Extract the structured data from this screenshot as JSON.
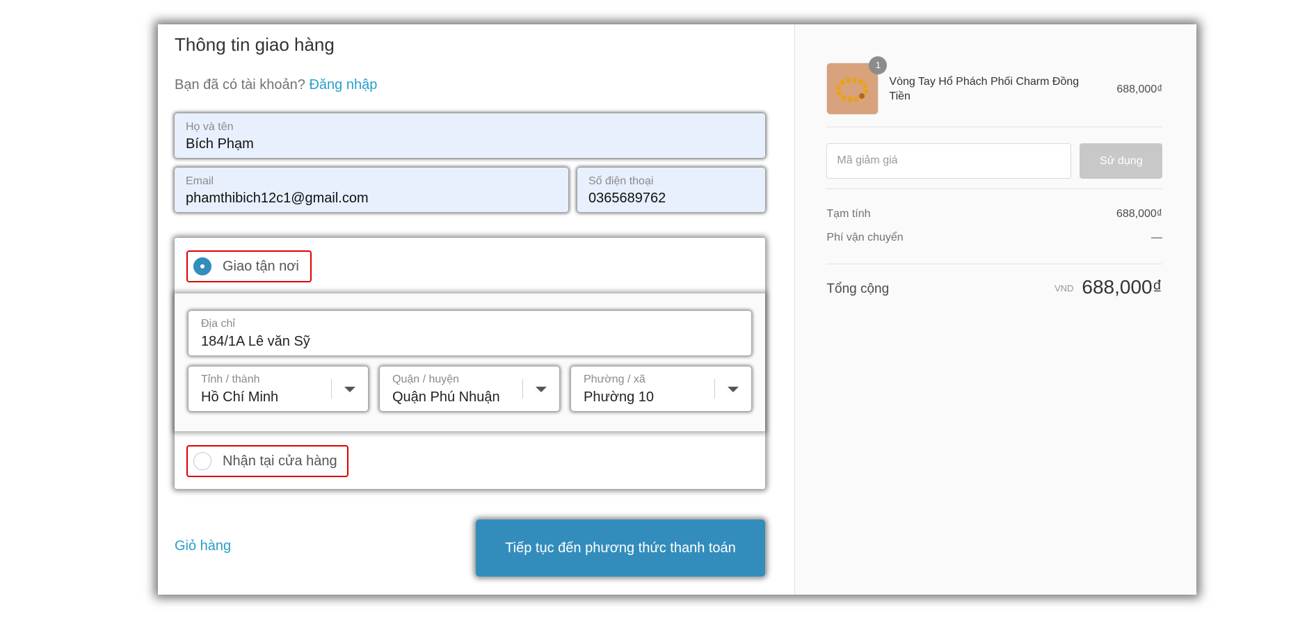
{
  "shipping_form": {
    "title": "Thông tin giao hàng",
    "have_account_text": "Bạn đã có tài khoản?",
    "login_link": "Đăng nhập",
    "fullname": {
      "label": "Họ và tên",
      "value": "Bích Phạm"
    },
    "email": {
      "label": "Email",
      "value": "phamthibich12c1@gmail.com"
    },
    "phone": {
      "label": "Số điện thoại",
      "value": "0365689762"
    },
    "delivery_options": [
      {
        "label": "Giao tận nơi",
        "selected": true
      },
      {
        "label": "Nhận tại cửa hàng",
        "selected": false
      }
    ],
    "address": {
      "label": "Địa chỉ",
      "value": "184/1A Lê văn Sỹ"
    },
    "province": {
      "label": "Tỉnh / thành",
      "value": "Hồ Chí Minh"
    },
    "district": {
      "label": "Quận / huyện",
      "value": "Quận Phú Nhuận"
    },
    "ward": {
      "label": "Phường / xã",
      "value": "Phường 10"
    },
    "back_link": "Giỏ hàng",
    "continue_button": "Tiếp tục đến phương thức thanh toán"
  },
  "order_summary": {
    "item": {
      "quantity": "1",
      "name": "Vòng Tay Hổ Phách Phối Charm Đồng Tiền",
      "price": "688,000₫"
    },
    "discount": {
      "placeholder": "Mã giảm giá",
      "apply_label": "Sử dụng"
    },
    "subtotal_label": "Tạm tính",
    "subtotal_value": "688,000₫",
    "shipping_label": "Phí vận chuyển",
    "shipping_value": "—",
    "total_label": "Tổng cộng",
    "currency": "VND",
    "total_value": "688,000₫"
  },
  "colors": {
    "accent": "#338dbc",
    "link": "#2a9dcc",
    "highlight_outline": "#e00000",
    "autofill_bg": "#e8f0fe",
    "sidebar_bg": "#fafafa"
  }
}
